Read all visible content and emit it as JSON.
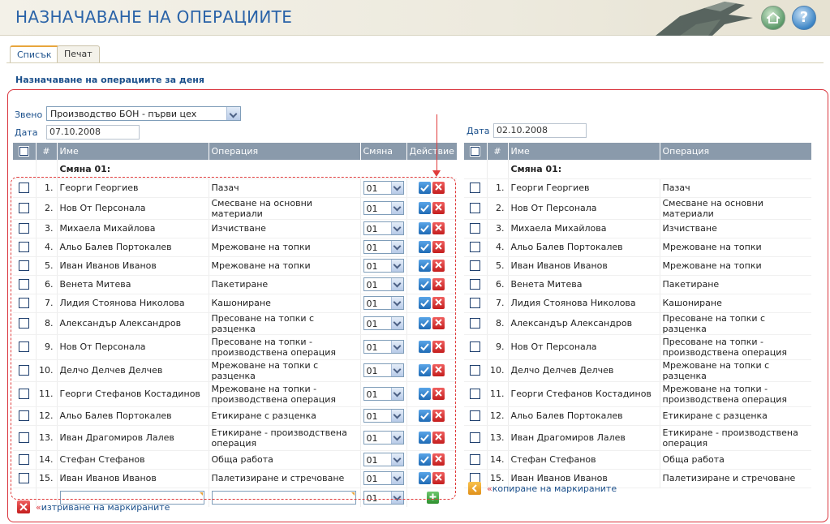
{
  "header": {
    "title": "НАЗНАЧАВАНЕ НА ОПЕРАЦИИТЕ",
    "help_label": "?"
  },
  "tabs": [
    {
      "label": "Списък",
      "active": true
    },
    {
      "label": "Печат",
      "active": false
    }
  ],
  "section_title": "Назначаване на операциите за деня",
  "filters": {
    "unit_label": "Звено",
    "unit_value": "Производство БОН - първи цех",
    "date_label": "Дата",
    "date_value": "07.10.2008",
    "right_date_label": "Дата",
    "right_date_value": "02.10.2008"
  },
  "left_table": {
    "headers": {
      "num": "#",
      "name": "Име",
      "operation": "Операция",
      "shift": "Смяна",
      "action": "Действие"
    },
    "group_label": "Смяна 01:",
    "new_row_shift": "01"
  },
  "right_table": {
    "headers": {
      "num": "#",
      "name": "Име",
      "operation": "Операция"
    },
    "group_label": "Смяна 01:"
  },
  "rows": [
    {
      "num": "1.",
      "name": "Георги Георгиев",
      "operation": "Пазач",
      "shift": "01"
    },
    {
      "num": "2.",
      "name": "Нов От Персонала",
      "operation": "Смесване на основни материали",
      "shift": "01"
    },
    {
      "num": "3.",
      "name": "Михаела Михайлова",
      "operation": "Изчистване",
      "shift": "01"
    },
    {
      "num": "4.",
      "name": "Альо Балев Портокалев",
      "operation": "Мрежоване на топки",
      "shift": "01"
    },
    {
      "num": "5.",
      "name": "Иван Иванов Иванов",
      "operation": "Мрежоване на топки",
      "shift": "01"
    },
    {
      "num": "6.",
      "name": "Венета Митева",
      "operation": "Пакетиране",
      "shift": "01"
    },
    {
      "num": "7.",
      "name": "Лидия Стоянова Николова",
      "operation": "Кашониране",
      "shift": "01"
    },
    {
      "num": "8.",
      "name": "Александър Александров",
      "operation": "Пресоване на топки с разценка",
      "shift": "01"
    },
    {
      "num": "9.",
      "name": "Нов От Персонала",
      "operation": "Пресоване на топки - производствена операция",
      "shift": "01"
    },
    {
      "num": "10.",
      "name": "Делчо Делчев Делчев",
      "operation": "Мрежоване на топки с разценка",
      "shift": "01"
    },
    {
      "num": "11.",
      "name": "Георги Стефанов Костадинов",
      "operation": "Мрежоване на топки - производствена операция",
      "shift": "01"
    },
    {
      "num": "12.",
      "name": "Альо Балев Портокалев",
      "operation": "Етикиране с разценка",
      "shift": "01"
    },
    {
      "num": "13.",
      "name": "Иван Драгомиров Лалев",
      "operation": "Етикиране - производствена операция",
      "shift": "01"
    },
    {
      "num": "14.",
      "name": "Стефан Стефанов",
      "operation": "Обща работа",
      "shift": "01"
    },
    {
      "num": "15.",
      "name": "Иван Иванов Иванов",
      "operation": "Палетизиране и стречоване",
      "shift": "01"
    }
  ],
  "links": {
    "delete_marked": "изтриване на маркираните",
    "copy_marked": "копиране на маркираните",
    "prefix": "«"
  },
  "colors": {
    "accent": "#2a63a8",
    "table_header": "#8a9aab",
    "frame_red": "#d9333b",
    "confirm_blue": "#1f6bb5",
    "delete_red": "#c41e1e",
    "add_green": "#2e8f2e"
  },
  "icons": {
    "home": "home-icon",
    "help": "help-icon",
    "confirm": "check-icon",
    "delete": "close-icon",
    "add": "plus-icon",
    "copy": "arrow-left-icon"
  }
}
